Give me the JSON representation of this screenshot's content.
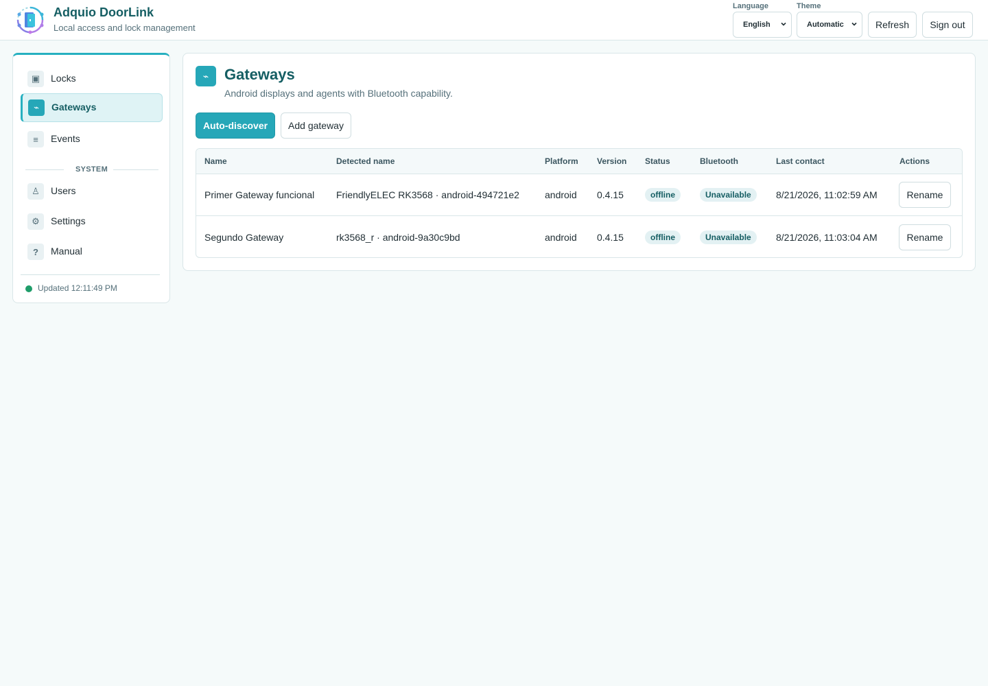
{
  "header": {
    "title": "Adquio DoorLink",
    "subtitle": "Local access and lock management",
    "language_label": "Language",
    "language_value": "English",
    "theme_label": "Theme",
    "theme_value": "Automatic",
    "refresh_label": "Refresh",
    "signout_label": "Sign out"
  },
  "sidebar": {
    "items": [
      {
        "label": "Locks",
        "icon": "lock-icon",
        "glyph": "▣"
      },
      {
        "label": "Gateways",
        "icon": "gateway-icon",
        "glyph": "⌁",
        "active": true
      },
      {
        "label": "Events",
        "icon": "events-icon",
        "glyph": "≡"
      }
    ],
    "section_label": "SYSTEM",
    "system_items": [
      {
        "label": "Users",
        "icon": "user-icon",
        "glyph": "♙"
      },
      {
        "label": "Settings",
        "icon": "gear-icon",
        "glyph": "⚙"
      },
      {
        "label": "Manual",
        "icon": "help-icon",
        "glyph": "?"
      }
    ],
    "status_text": "Updated 12:11:49 PM",
    "status_color": "#1f9d6a"
  },
  "main": {
    "icon_glyph": "⌁",
    "title": "Gateways",
    "subtitle": "Android displays and agents with Bluetooth capability.",
    "autodiscover_label": "Auto-discover",
    "add_label": "Add gateway",
    "columns": [
      "Name",
      "Detected name",
      "Platform",
      "Version",
      "Status",
      "Bluetooth",
      "Last contact",
      "Actions"
    ],
    "rows": [
      {
        "name": "Primer Gateway funcional",
        "detected": "FriendlyELEC RK3568 · android-494721e2",
        "platform": "android",
        "version": "0.4.15",
        "status": "offline",
        "bluetooth": "Unavailable",
        "last_contact": "8/21/2026, 11:02:59 AM",
        "action": "Rename"
      },
      {
        "name": "Segundo Gateway",
        "detected": "rk3568_r · android-9a30c9bd",
        "platform": "android",
        "version": "0.4.15",
        "status": "offline",
        "bluetooth": "Unavailable",
        "last_contact": "8/21/2026, 11:03:04 AM",
        "action": "Rename"
      }
    ]
  },
  "colors": {
    "accent": "#26a7b8",
    "title": "#155e63",
    "background": "#f5fafa"
  }
}
